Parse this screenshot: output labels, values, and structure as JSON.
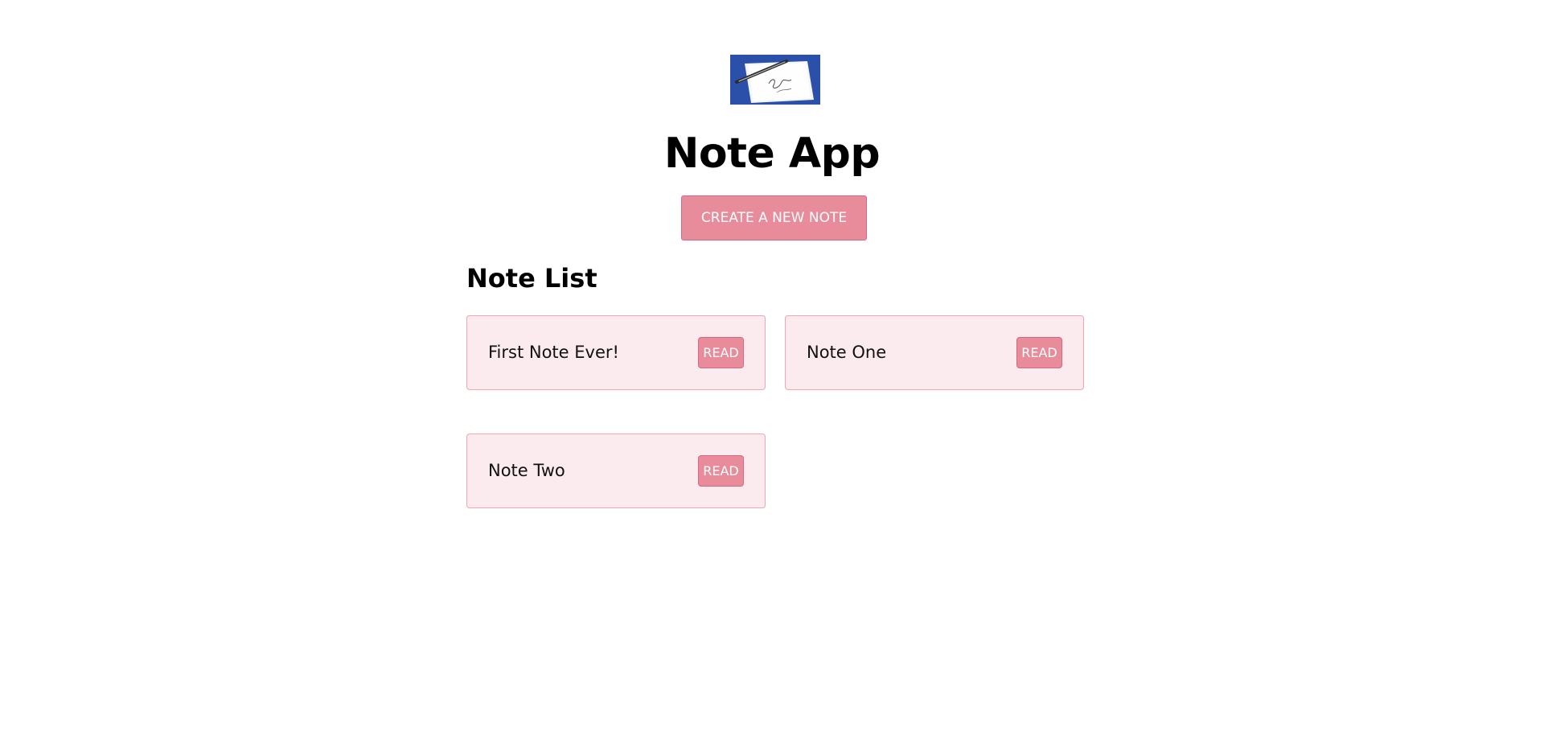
{
  "app": {
    "title": "Note App",
    "create_button_label": "CREATE A NEW NOTE",
    "logo_icon": "envelope-note-logo"
  },
  "note_list": {
    "heading": "Note List",
    "notes": [
      {
        "title": "First Note Ever!",
        "action_label": "READ"
      },
      {
        "title": "Note One",
        "action_label": "READ"
      },
      {
        "title": "Note Two",
        "action_label": "READ"
      }
    ]
  },
  "colors": {
    "accent": "#e88c9c",
    "accent_border": "#d7687d",
    "card_background": "#fbebee",
    "card_border": "#f1a6b4",
    "logo_blue": "#2f58b8"
  }
}
